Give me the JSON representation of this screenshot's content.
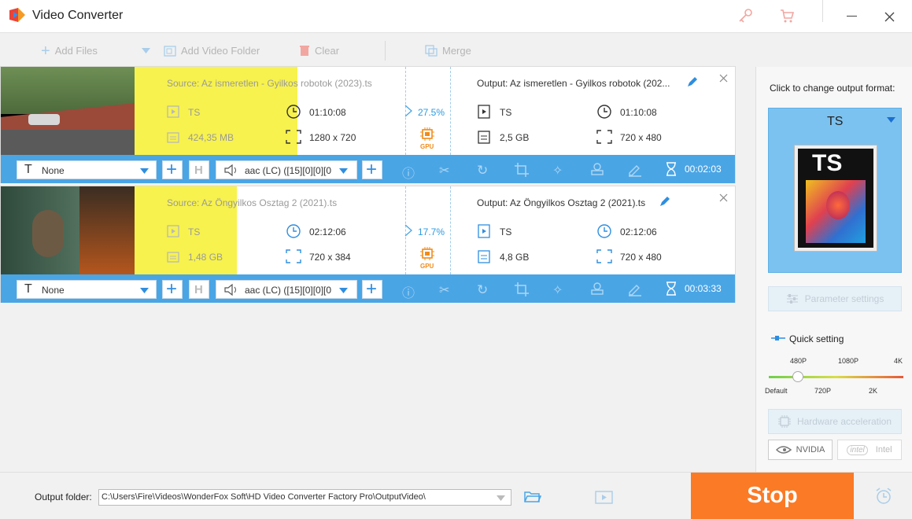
{
  "app": {
    "title": "Video Converter"
  },
  "toolbar": {
    "add_files": "Add Files",
    "add_folder": "Add Video Folder",
    "clear": "Clear",
    "merge": "Merge"
  },
  "items": [
    {
      "source": "Source: Az ismeretlen - Gyilkos robotok (2023).ts",
      "src_format": "TS",
      "src_duration": "01:10:08",
      "src_size": "424,35 MB",
      "src_resolution": "1280 x 720",
      "progress": "27.5%",
      "gpu": "GPU",
      "output": "Output: Az ismeretlen - Gyilkos robotok (202...",
      "out_format": "TS",
      "out_duration": "01:10:08",
      "out_size": "2,5 GB",
      "out_resolution": "720 x 480",
      "subtitle": "None",
      "audio": "aac (LC) ([15][0][0][0",
      "time": "00:02:03"
    },
    {
      "source": "Source: Az Öngyilkos Osztag 2 (2021).ts",
      "src_format": "TS",
      "src_duration": "02:12:06",
      "src_size": "1,48 GB",
      "src_resolution": "720 x 384",
      "progress": "17.7%",
      "gpu": "GPU",
      "output": "Output: Az Öngyilkos Osztag 2 (2021).ts",
      "out_format": "TS",
      "out_duration": "02:12:06",
      "out_size": "4,8 GB",
      "out_resolution": "720 x 480",
      "subtitle": "None",
      "audio": "aac (LC) ([15][0][0][0",
      "time": "00:03:33"
    }
  ],
  "right_panel": {
    "click_hint": "Click to change output format:",
    "format": "TS",
    "format_icon_text": "TS",
    "param_settings": "Parameter settings",
    "quick_setting": "Quick setting",
    "slider_top": [
      "480P",
      "1080P",
      "4K"
    ],
    "slider_bottom": [
      "Default",
      "720P",
      "2K"
    ],
    "hw_accel": "Hardware acceleration",
    "nvidia": "NVIDIA",
    "intel": "Intel"
  },
  "bottom": {
    "output_folder_label": "Output folder:",
    "output_path": "C:\\Users\\Fire\\Videos\\WonderFox Soft\\HD Video Converter Factory Pro\\OutputVideo\\",
    "stop": "Stop"
  },
  "colors": {
    "accent": "#4aa5e5",
    "stop": "#fb7a25",
    "highlight": "#f7f24d"
  }
}
